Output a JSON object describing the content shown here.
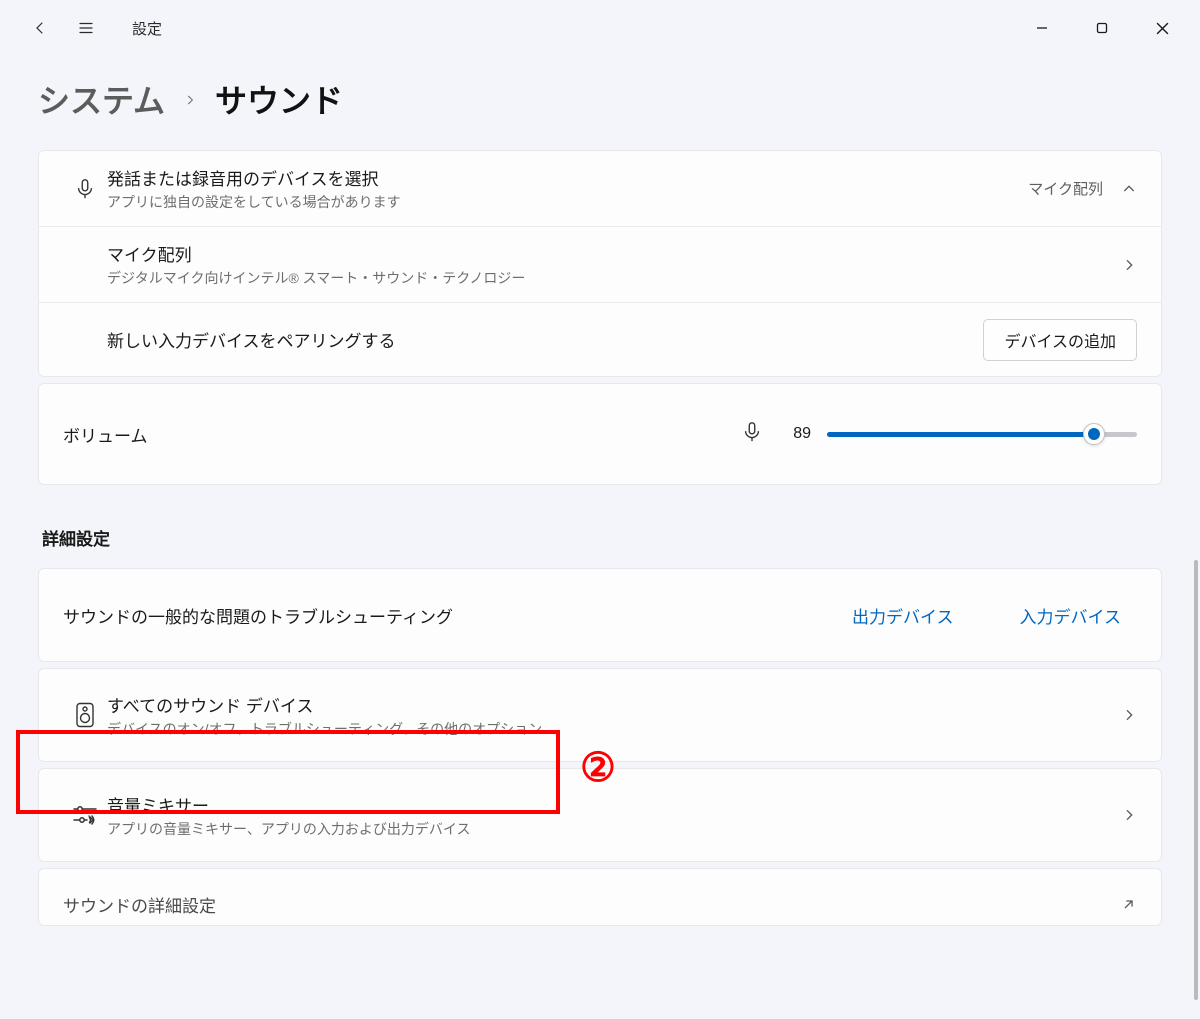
{
  "app_title": "設定",
  "breadcrumb": {
    "parent": "システム",
    "current": "サウンド"
  },
  "input_device_card": {
    "title": "発話または録音用のデバイスを選択",
    "subtitle": "アプリに独自の設定をしている場合があります",
    "selected": "マイク配列"
  },
  "mic_device": {
    "title": "マイク配列",
    "subtitle": "デジタルマイク向けインテル® スマート・サウンド・テクノロジー"
  },
  "pair_row": {
    "label": "新しい入力デバイスをペアリングする",
    "button": "デバイスの追加"
  },
  "volume": {
    "label": "ボリューム",
    "value": "89",
    "percent": 86
  },
  "advanced_heading": "詳細設定",
  "troubleshoot": {
    "label": "サウンドの一般的な問題のトラブルシューティング",
    "output_btn": "出力デバイス",
    "input_btn": "入力デバイス"
  },
  "all_devices": {
    "title": "すべてのサウンド デバイス",
    "subtitle": "デバイスのオン/オフ、トラブルシューティング、その他のオプション"
  },
  "mixer": {
    "title": "音量ミキサー",
    "subtitle": "アプリの音量ミキサー、アプリの入力および出力デバイス"
  },
  "more_settings": {
    "title": "サウンドの詳細設定"
  },
  "annotation": {
    "label": "②"
  }
}
